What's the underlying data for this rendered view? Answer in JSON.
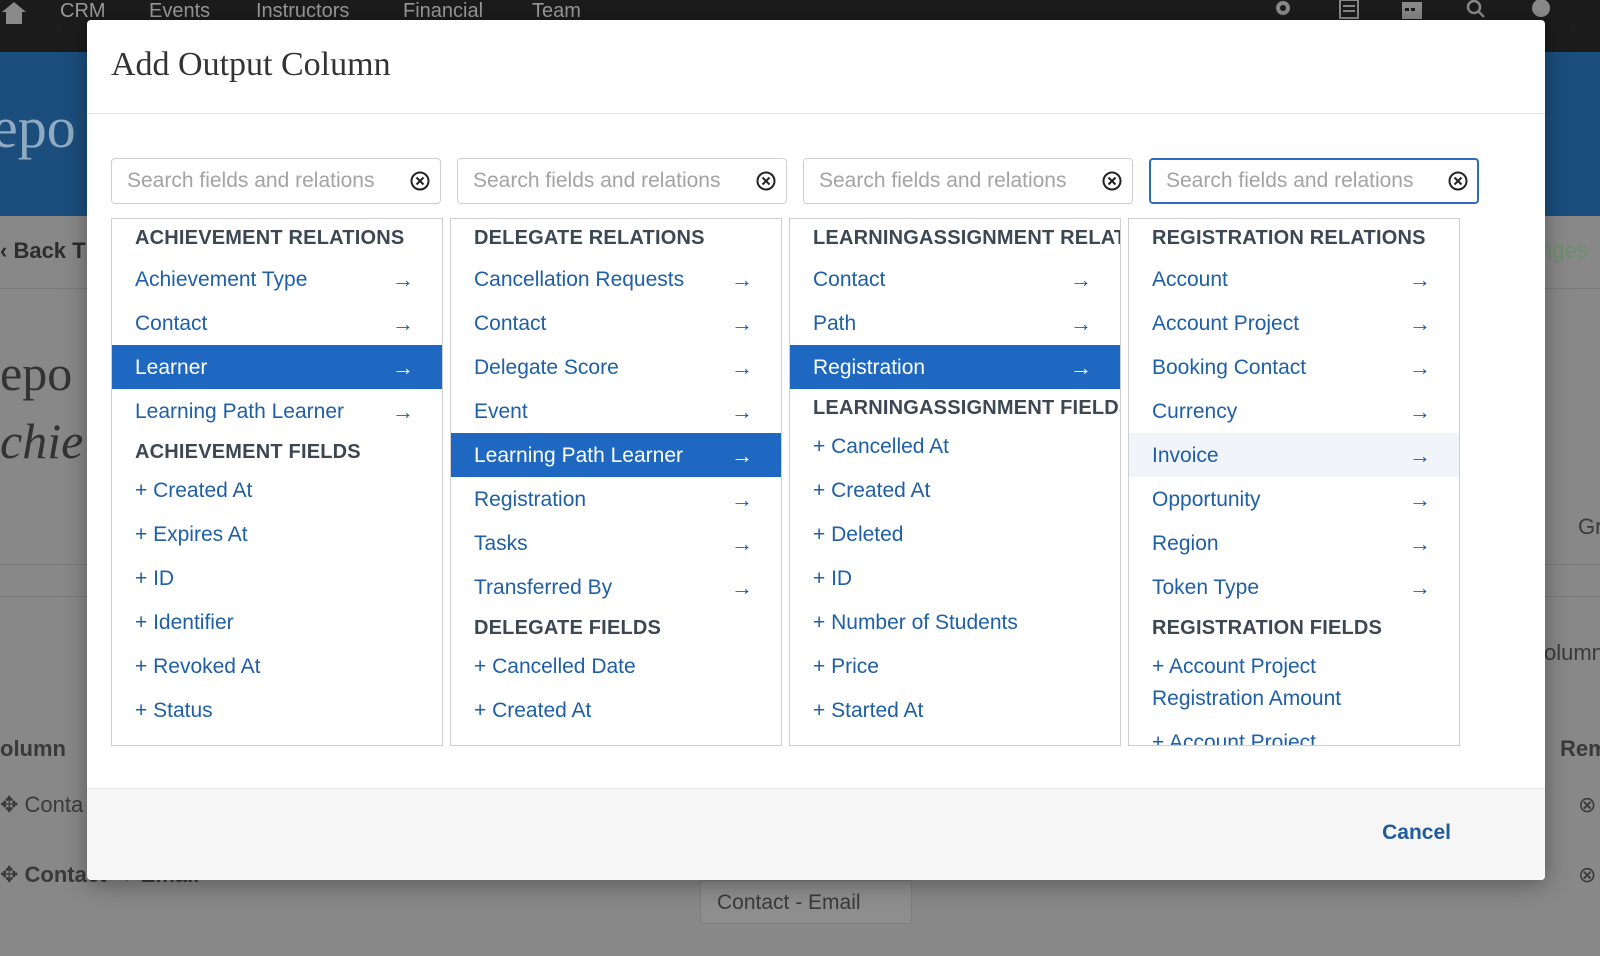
{
  "app": {
    "nav": [
      "CRM",
      "Events",
      "Instructors",
      "Financial",
      "Team"
    ],
    "hero_title": "epo",
    "back_label": "Back T",
    "save_partial": "nges",
    "big_text_1": "epo",
    "big_text_2": "chie",
    "right_partial_1": "Gr",
    "right_partial_2": "olumn",
    "column_label": "olumn",
    "remove_label": "Rem",
    "row1": "Conta",
    "row2": "Contact → Email",
    "input_value": "Contact - Email"
  },
  "modal": {
    "title": "Add Output Column",
    "cancel_label": "Cancel",
    "search_placeholder": "Search fields and relations"
  },
  "columns": [
    {
      "relations_header": "ACHIEVEMENT RELATIONS",
      "relations": [
        "Achievement Type",
        "Contact",
        "Learner",
        "Learning Path Learner"
      ],
      "fields_header": "ACHIEVEMENT FIELDS",
      "fields": [
        "+ Created At",
        "+ Expires At",
        "+ ID",
        "+ Identifier",
        "+ Revoked At",
        "+ Status"
      ]
    },
    {
      "relations_header": "DELEGATE RELATIONS",
      "relations": [
        "Cancellation Requests",
        "Contact",
        "Delegate Score",
        "Event",
        "Learning Path Learner",
        "Registration",
        "Tasks",
        "Transferred By"
      ],
      "fields_header": "DELEGATE FIELDS",
      "fields": [
        "+ Cancelled Date",
        "+ Created At"
      ]
    },
    {
      "relations_header": "LEARNINGASSIGNMENT RELATI",
      "relations": [
        "Contact",
        "Path",
        "Registration"
      ],
      "fields_header": "LEARNINGASSIGNMENT FIELDS",
      "fields": [
        "+ Cancelled At",
        "+ Created At",
        "+ Deleted",
        "+ ID",
        "+ Number of Students",
        "+ Price",
        "+ Started At"
      ]
    },
    {
      "relations_header": "REGISTRATION RELATIONS",
      "relations": [
        "Account",
        "Account Project",
        "Booking Contact",
        "Currency",
        "Invoice",
        "Opportunity",
        "Region",
        "Token Type"
      ],
      "fields_header": "REGISTRATION FIELDS",
      "fields": [
        "+ Account Project",
        "Registration Amount",
        "+ Account Project"
      ]
    }
  ],
  "arrow": "→",
  "colors": {
    "selected": "#1e68c2",
    "link": "#1e5fa8",
    "header_bg": "#1b4e7d"
  }
}
